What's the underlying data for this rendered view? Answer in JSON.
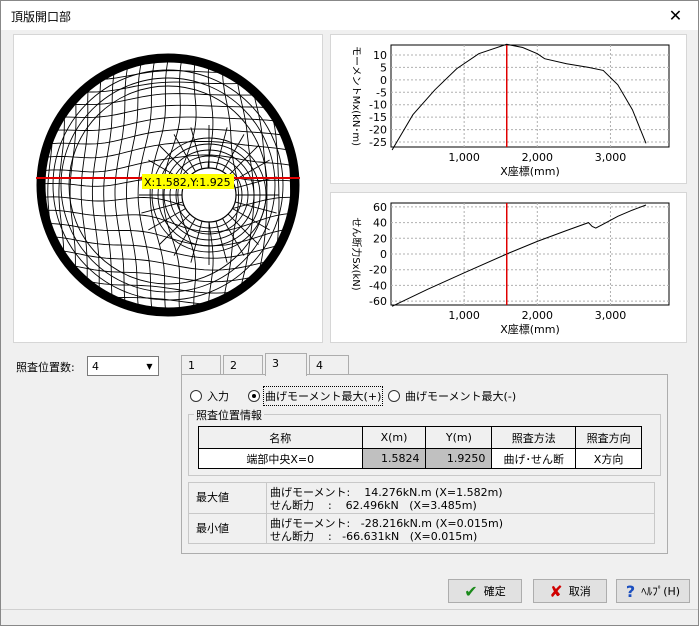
{
  "window": {
    "title": "頂版開口部",
    "close_glyph": "✕"
  },
  "mesh": {
    "cursor_label": "X:1.582,Y:1.925"
  },
  "moment_chart": {
    "ylabel": "モーメントMx(kN･m)",
    "xlabel": "X座標(mm)",
    "yticks": [
      "10",
      "5",
      "0",
      "-5",
      "-10",
      "-15",
      "-20",
      "-25"
    ],
    "xticks": [
      "1,000",
      "2,000",
      "3,000"
    ]
  },
  "shear_chart": {
    "ylabel": "せん断力Sx(kN)",
    "xlabel": "X座標(mm)",
    "yticks": [
      "60",
      "40",
      "20",
      "0",
      "-20",
      "-40",
      "-60"
    ],
    "xticks": [
      "1,000",
      "2,000",
      "3,000"
    ]
  },
  "chart_data": [
    {
      "type": "line",
      "title": "",
      "xlabel": "X座標(mm)",
      "ylabel": "モーメントMx(kN･m)",
      "xlim": [
        0,
        3800
      ],
      "ylim": [
        -27,
        14
      ],
      "x": [
        15,
        300,
        600,
        900,
        1200,
        1582,
        1800,
        2000,
        2100,
        2400,
        2700,
        2900,
        3100,
        3300,
        3485
      ],
      "values": [
        -28.2,
        -14,
        -4,
        4.5,
        10.5,
        14.3,
        13,
        10.5,
        8.5,
        6.5,
        5,
        3.8,
        -2,
        -12,
        -25.5
      ],
      "series": [
        {
          "values": [
            -28.2,
            -14,
            -4,
            4.5,
            10.5,
            14.3,
            13,
            10.5,
            8.5,
            6.5,
            5,
            3.8,
            -2,
            -12,
            -25.5
          ]
        }
      ]
    },
    {
      "type": "line",
      "title": "",
      "xlabel": "X座標(mm)",
      "ylabel": "せん断力Sx(kN)",
      "xlim": [
        0,
        3800
      ],
      "ylim": [
        -65,
        65
      ],
      "x": [
        15,
        500,
        1000,
        1582,
        2000,
        2400,
        2700,
        2750,
        2800,
        2900,
        3100,
        3300,
        3485
      ],
      "values": [
        -66.6,
        -45,
        -24,
        0,
        16,
        30,
        40,
        35,
        33,
        38,
        48,
        56,
        62.5
      ],
      "series": [
        {
          "values": [
            -66.6,
            -45,
            -24,
            0,
            16,
            30,
            40,
            35,
            33,
            38,
            48,
            56,
            62.5
          ]
        }
      ]
    }
  ],
  "positions": {
    "label": "照査位置数:",
    "value": "4"
  },
  "tabs": [
    "1",
    "2",
    "3",
    "4"
  ],
  "radios": {
    "input": "入力",
    "max_pos": "曲げモーメント最大(+)",
    "max_neg": "曲げモーメント最大(-)"
  },
  "info_group": {
    "title": "照査位置情報"
  },
  "table": {
    "headers": [
      "名称",
      "X(m)",
      "Y(m)",
      "照査方法",
      "照査方向"
    ],
    "row": [
      "端部中央X=0",
      "1.5824",
      "1.9250",
      "曲げ･せん断",
      "X方向"
    ]
  },
  "results": {
    "max_label": "最大値",
    "min_label": "最小値",
    "max_text": "曲げモーメント:    14.276kN.m (X=1.582m)\nせん断力    :    62.496kN   (X=3.485m)",
    "min_text": "曲げモーメント:   -28.216kN.m (X=0.015m)\nせん断力    :   -66.631kN   (X=0.015m)"
  },
  "buttons": {
    "ok": "確定",
    "cancel": "取消",
    "help": "ﾍﾙﾌﾟ(H)"
  },
  "colors": {
    "marker": "#e00000",
    "label_bg": "#ffff00",
    "ok_icon": "#1a8a1a",
    "cancel_icon": "#d00000",
    "help_icon": "#1c4fbf"
  }
}
